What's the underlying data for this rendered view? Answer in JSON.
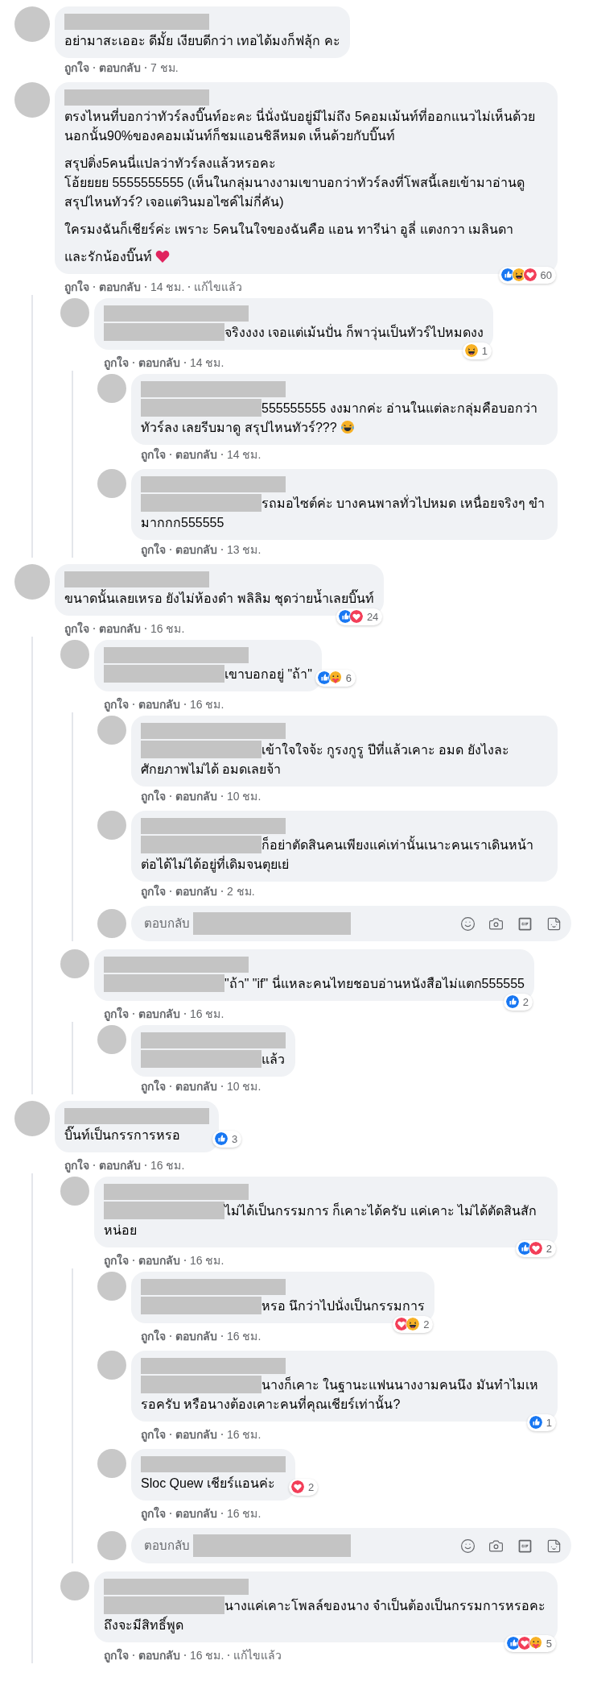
{
  "comments": [
    {
      "kind": "comment",
      "mention": false,
      "body": [
        "อย่ามาสะเออะ ดีมั้ย เงียบดีกว่า เทอได้มงก็ฟลุ้ก คะ"
      ],
      "meta": {
        "like": "ถูกใจ",
        "reply": "ตอบกลับ",
        "time": "7 ชม."
      }
    },
    {
      "kind": "comment",
      "mention": false,
      "body": [
        "ตรงไหนที่บอกว่าทัวร์ลงบิ๊นท์อะคะ นี่นั่งนับอยู่มีไม่ถึง 5คอมเม้นท์ที่ออกแนวไม่เห็นด้วย นอกนั้น90%ของคอมเม้นท์ก็ชมแอนชิลีหมด เห็นด้วยกับบิ๊นท์",
        "สรุปติ่ง5คนนี่แปลว่าทัวร์ลงแล้วหรอคะ\nโอ้ยยยย 5555555555 (เห็นในกลุ่มนางงามเขาบอกว่าทัวร์ลงที่โพสนี้เลยเข้ามาอ่านดู สรุปไหนทัวร์? เจอแต่วินมอไซค์ไม่กี่คัน)",
        "ใครมงฉันก็เชียร์ค่ะ เพราะ 5คนในใจของฉันคือ แอน ทารีน่า อูลี่ แตงกวา เมลินดา",
        "และรักน้องบิ๊นท์"
      ],
      "emoji": {
        "kind": "heart"
      },
      "reactions": {
        "icons": [
          {
            "kind": "like"
          },
          {
            "kind": "haha"
          },
          {
            "kind": "love"
          }
        ],
        "count": "60"
      },
      "meta": {
        "like": "ถูกใจ",
        "reply": "ตอบกลับ",
        "time": "14 ชม.",
        "edited": "แก้ไขแล้ว"
      },
      "children": [
        {
          "kind": "comment",
          "mention": true,
          "body": [
            "จริงงงง เจอแต่เม้นปั่น ก็พาวุ่นเป็นทัวร์ไปหมดงง"
          ],
          "reactions": {
            "icons": [
              {
                "kind": "haha"
              }
            ],
            "count": "1"
          },
          "meta": {
            "like": "ถูกใจ",
            "reply": "ตอบกลับ",
            "time": "14 ชม."
          },
          "children": [
            {
              "kind": "comment",
              "mention": true,
              "body": [
                "555555555 งงมากค่ะ อ่านในแต่ละกลุ่มคือบอกว่าทัวร์ลง เลยรีบมาดู สรุปไหนทัวร์???"
              ],
              "emoji": {
                "kind": "laugh_cry"
              },
              "meta": {
                "like": "ถูกใจ",
                "reply": "ตอบกลับ",
                "time": "14 ชม."
              }
            },
            {
              "kind": "comment",
              "mention": true,
              "body": [
                "รถมอไซต์ค่ะ บางคนพาลทั่วไปหมด เหนื่อยจริงๆ ขำมากกก555555"
              ],
              "meta": {
                "like": "ถูกใจ",
                "reply": "ตอบกลับ",
                "time": "13 ชม."
              }
            }
          ]
        }
      ]
    },
    {
      "kind": "comment",
      "mention": false,
      "body": [
        "ขนาดนั้นเลยเหรอ ยังไม่ห้องดำ พลิลิม ชุดว่ายน้ำเลยบิ๊นท์"
      ],
      "reactions": {
        "icons": [
          {
            "kind": "like"
          },
          {
            "kind": "love"
          }
        ],
        "count": "24"
      },
      "meta": {
        "like": "ถูกใจ",
        "reply": "ตอบกลับ",
        "time": "16 ชม."
      },
      "children": [
        {
          "kind": "comment",
          "mention": true,
          "body": [
            "เขาบอกอยู่ \"ถ้า\""
          ],
          "reactions": {
            "icons": [
              {
                "kind": "like"
              },
              {
                "kind": "care"
              }
            ],
            "count": "6"
          },
          "meta": {
            "like": "ถูกใจ",
            "reply": "ตอบกลับ",
            "time": "16 ชม."
          },
          "children": [
            {
              "kind": "comment",
              "mention": true,
              "body": [
                "เข้าใจใจจ้ะ กูรงกูรู ปีที่แล้วเคาะ อมด ยังไงละ ศักยภาพไม่ได้ อมดเลยจ้า"
              ],
              "meta": {
                "like": "ถูกใจ",
                "reply": "ตอบกลับ",
                "time": "10 ชม."
              }
            },
            {
              "kind": "comment",
              "mention": true,
              "body": [
                "ก็อย่าตัดสินคนเพียงแค่เท่านั้นเนาะคนเราเดินหน้าต่อได้ไม่ได้อยู่ที่เดิมจนตุยเย่"
              ],
              "meta": {
                "like": "ถูกใจ",
                "reply": "ตอบกลับ",
                "time": "2 ชม."
              }
            },
            {
              "kind": "reply_box",
              "placeholder": "ตอบกลับ"
            }
          ]
        },
        {
          "kind": "comment",
          "mention": true,
          "body": [
            "\"ถ้า\" \"if\" นี่แหละคนไทยชอบอ่านหนังสือไม่แตก555555"
          ],
          "reactions": {
            "icons": [
              {
                "kind": "like"
              }
            ],
            "count": "2"
          },
          "meta": {
            "like": "ถูกใจ",
            "reply": "ตอบกลับ",
            "time": "16 ชม."
          },
          "children": [
            {
              "kind": "comment",
              "mention": true,
              "body": [
                "แล้ว"
              ],
              "meta": {
                "like": "ถูกใจ",
                "reply": "ตอบกลับ",
                "time": "10 ชม."
              }
            }
          ]
        }
      ]
    },
    {
      "kind": "comment",
      "mention": false,
      "body": [
        "บิ๊นท์เป็นกรรการหรอ"
      ],
      "reactions": {
        "icons": [
          {
            "kind": "like"
          }
        ],
        "count": "3"
      },
      "meta": {
        "like": "ถูกใจ",
        "reply": "ตอบกลับ",
        "time": "16 ชม."
      },
      "children": [
        {
          "kind": "comment",
          "mention": true,
          "body": [
            "ไม่ได้เป็นกรรมการ ก็เคาะได้ครับ แค่เคาะ ไม่ได้ตัดสินสักหน่อย"
          ],
          "reactions": {
            "icons": [
              {
                "kind": "like"
              },
              {
                "kind": "love"
              }
            ],
            "count": "2"
          },
          "meta": {
            "like": "ถูกใจ",
            "reply": "ตอบกลับ",
            "time": "16 ชม."
          },
          "children": [
            {
              "kind": "comment",
              "mention": true,
              "body": [
                "หรอ นึกว่าไปนั่งเป็นกรรมการ"
              ],
              "reactions": {
                "icons": [
                  {
                    "kind": "love"
                  },
                  {
                    "kind": "haha"
                  }
                ],
                "count": "2"
              },
              "meta": {
                "like": "ถูกใจ",
                "reply": "ตอบกลับ",
                "time": "16 ชม."
              }
            },
            {
              "kind": "comment",
              "mention": true,
              "body": [
                "นางก็เคาะ ในฐานะแฟนนางงามคนนึง มันทำไมเหรอครับ หรือนางต้องเคาะคนที่คุณเชียร์เท่านั้น?"
              ],
              "reactions": {
                "icons": [
                  {
                    "kind": "like"
                  }
                ],
                "count": "1"
              },
              "meta": {
                "like": "ถูกใจ",
                "reply": "ตอบกลับ",
                "time": "16 ชม."
              }
            },
            {
              "kind": "comment",
              "mention": false,
              "body": [
                "Sloc Quew เชียร์แอนค่ะ"
              ],
              "reactions": {
                "icons": [
                  {
                    "kind": "love"
                  }
                ],
                "count": "2"
              },
              "meta": {
                "like": "ถูกใจ",
                "reply": "ตอบกลับ",
                "time": "16 ชม."
              }
            },
            {
              "kind": "reply_box",
              "placeholder": "ตอบกลับ"
            }
          ]
        },
        {
          "kind": "comment",
          "mention": true,
          "body": [
            "นางแค่เคาะโพลล์ของนาง จำเป็นต้องเป็นกรรมการหรอคะถึงจะมีสิทธิ์พูด"
          ],
          "reactions": {
            "icons": [
              {
                "kind": "like"
              },
              {
                "kind": "love"
              },
              {
                "kind": "care"
              }
            ],
            "count": "5"
          },
          "meta": {
            "like": "ถูกใจ",
            "reply": "ตอบกลับ",
            "time": "16 ชม.",
            "edited": "แก้ไขแล้ว"
          }
        }
      ]
    }
  ]
}
